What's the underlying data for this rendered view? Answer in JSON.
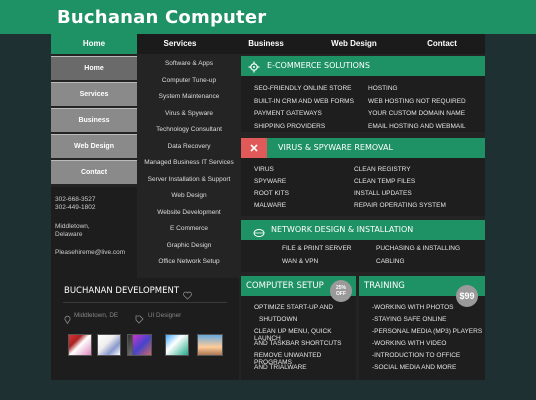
{
  "site": {
    "title": "Buchanan Computer"
  },
  "nav": {
    "items": [
      "Home",
      "Services",
      "Business",
      "Web Design",
      "Contact"
    ]
  },
  "sidebar": {
    "items": [
      "Home",
      "Services",
      "Business",
      "Web Design",
      "Contact"
    ]
  },
  "contact": {
    "phone1": "302-668-3527",
    "phone2": "302-449-1802",
    "city": "Middletown,",
    "state": "Delaware",
    "email": "Pleasehireme@live.com"
  },
  "services_list": [
    "Software & Apps",
    "Computer Tune-up",
    "System Maintenance",
    "Virus & Spyware",
    "Technology Consultant",
    "Data Recovery",
    "Managed Business IT Services",
    "Server Installation & Support",
    "Web Design",
    "Website Development",
    "E Commerce",
    "Graphic Design",
    "Office Network Setup"
  ],
  "ecommerce": {
    "title": "E-COMMERCE SOLUTIONS",
    "left": [
      "SEO-FRIENDLY ONLINE STORE",
      "BUILT-IN CRM AND WEB FORMS",
      "PAYMENT GATEWAYS",
      "SHIPPING PROVIDERS"
    ],
    "right": [
      "HOSTING",
      "WEB HOSTING NOT REQUIRED",
      "YOUR CUSTOM DOMAIN NAME",
      "EMAIL HOSTING AND WEBMAIL"
    ]
  },
  "virus": {
    "title": "VIRUS & SPYWARE REMOVAL",
    "left": [
      "VIRUS",
      "SPYWARE",
      "ROOT KITS",
      "MALWARE"
    ],
    "right": [
      "CLEAN REGISTRY",
      "CLEAN TEMP FILES",
      "INSTALL UPDATES",
      "REPAIR OPERATING SYSTEM"
    ]
  },
  "network": {
    "title": "NETWORK DESIGN & INSTALLATION",
    "left": [
      "FILE & PRINT SERVER",
      "WAN & VPN"
    ],
    "right": [
      "PUCHASING & INSTALLING",
      "CABLING"
    ]
  },
  "development": {
    "title": "BUCHANAN DEVELOPMENT",
    "location": "Middletown, DE",
    "role": "UI Designer"
  },
  "setup": {
    "title": "COMPUTER SETUP",
    "badge_pct": "25%",
    "badge_off": "OFF",
    "lines": [
      "OPTIMIZE START-UP AND",
      "SHUTDOWN",
      "CLEAN UP MENU, QUICK LAUNCH",
      "AND TASKBAR SHORTCUTS",
      "REMOVE UNWANTED PROGRAMS",
      "AND TRIALWARE"
    ]
  },
  "training": {
    "title": "TRAINING",
    "price": "$99",
    "lines": [
      "-WORKING WITH PHOTOS",
      "-STAYING SAFE ONLINE",
      "-PERSONAL MEDIA (MP3) PLAYERS",
      "-WORKING WITH VIDEO",
      "-INTRODUCTION TO OFFICE",
      "-SOCIAL MEDIA AND MORE"
    ]
  },
  "colors": {
    "accent": "#1e9165",
    "virus_icon_bg": "#e05a5a",
    "background": "#1f3033"
  },
  "icons": {
    "ecommerce": "gear-icon",
    "virus": "close-icon",
    "network": "network-icon",
    "heart": "heart-icon",
    "location": "location-pin-icon",
    "tag": "tag-icon"
  }
}
